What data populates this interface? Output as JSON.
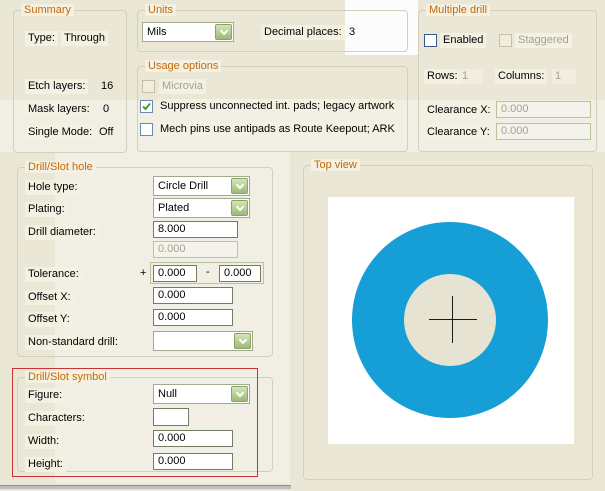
{
  "colors": {
    "background": "#eae7d6",
    "group_title": "#c4690a",
    "highlight_box_red": "#c73434",
    "pad_blue": "#169fd6",
    "hole_fill": "#e7e3d2",
    "combo_button_green": "#9cba78",
    "check_green": "#3aa43f"
  },
  "summary": {
    "title": "Summary",
    "type_label": "Type:",
    "type_value": "Through",
    "etch_label": "Etch layers:",
    "etch_value": "16",
    "mask_label": "Mask layers:",
    "mask_value": "0",
    "single_label": "Single Mode:",
    "single_value": "Off"
  },
  "units": {
    "title": "Units",
    "selected": "Mils",
    "decimal_label": "Decimal places:",
    "decimal_value": "3"
  },
  "usage_options": {
    "title": "Usage options",
    "items": [
      {
        "label": "Microvia",
        "checked": false,
        "disabled": true
      },
      {
        "label": "Suppress unconnected int. pads; legacy artwork",
        "checked": true,
        "disabled": false
      },
      {
        "label": "Mech pins use antipads as Route Keepout; ARK",
        "checked": false,
        "disabled": false
      }
    ]
  },
  "multiple_drill": {
    "title": "Multiple drill",
    "enabled_label": "Enabled",
    "enabled_checked": false,
    "staggered_label": "Staggered",
    "staggered_checked": false,
    "staggered_disabled": true,
    "rows_label": "Rows:",
    "rows_value": "1",
    "columns_label": "Columns:",
    "columns_value": "1",
    "clearance_x_label": "Clearance X:",
    "clearance_x_value": "0.000",
    "clearance_y_label": "Clearance Y:",
    "clearance_y_value": "0.000"
  },
  "drill_slot_hole": {
    "title": "Drill/Slot hole",
    "hole_type_label": "Hole type:",
    "hole_type_value": "Circle Drill",
    "plating_label": "Plating:",
    "plating_value": "Plated",
    "diameter_label": "Drill diameter:",
    "diameter_value": "8.000",
    "slot_length_value": "0.000",
    "tolerance_label": "Tolerance:",
    "plus_sign": "+",
    "tolerance_plus_value": "0.000",
    "minus_sign": "-",
    "tolerance_minus_value": "0.000",
    "offset_x_label": "Offset X:",
    "offset_x_value": "0.000",
    "offset_y_label": "Offset Y:",
    "offset_y_value": "0.000",
    "non_standard_label": "Non-standard drill:",
    "non_standard_value": ""
  },
  "drill_slot_symbol": {
    "title": "Drill/Slot symbol",
    "figure_label": "Figure:",
    "figure_value": "Null",
    "characters_label": "Characters:",
    "characters_value": "",
    "width_label": "Width:",
    "width_value": "0.000",
    "height_label": "Height:",
    "height_value": "0.000"
  },
  "top_view": {
    "title": "Top view"
  }
}
